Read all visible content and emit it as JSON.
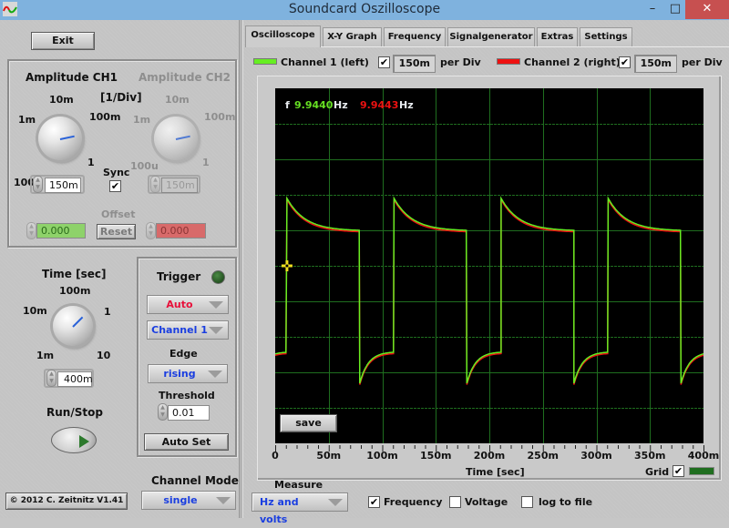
{
  "window": {
    "title": "Soundcard Oszilloscope",
    "minimize": "–",
    "maximize": "□",
    "close": "✕"
  },
  "left": {
    "exit_label": "Exit",
    "amplitude": {
      "ch1_title": "Amplitude CH1",
      "ch2_title": "Amplitude CH2",
      "unit": "[1/Div]",
      "scale_labels": [
        "100u",
        "1m",
        "10m",
        "100m",
        "1"
      ],
      "ch1_value": "150m",
      "ch2_value": "150m",
      "sync_label": "Sync",
      "sync_checked": true,
      "offset_label": "Offset",
      "offset_ch1": "0.000",
      "offset_ch2": "0.000",
      "reset_label": "Reset"
    },
    "time": {
      "title": "Time [sec]",
      "scale_labels": [
        "1m",
        "10m",
        "100m",
        "1",
        "10"
      ],
      "value": "400m"
    },
    "trigger": {
      "title": "Trigger",
      "mode": "Auto",
      "channel": "Channel 1",
      "edge_label": "Edge",
      "edge": "rising",
      "threshold_label": "Threshold",
      "threshold": "0.01",
      "auto_set_label": "Auto Set"
    },
    "run_stop_label": "Run/Stop",
    "channel_mode_label": "Channel Mode",
    "channel_mode": "single",
    "copyright": "© 2012  C. Zeitnitz V1.41"
  },
  "tabs": [
    {
      "label": "Oscilloscope",
      "active": true
    },
    {
      "label": "X-Y Graph",
      "active": false
    },
    {
      "label": "Frequency",
      "active": false
    },
    {
      "label": "Signalgenerator",
      "active": false
    },
    {
      "label": "Extras",
      "active": false
    },
    {
      "label": "Settings",
      "active": false
    }
  ],
  "channels": {
    "ch1_label": "Channel 1 (left)",
    "ch1_color": "#66ee22",
    "ch1_enabled": true,
    "ch1_per_div": "150m",
    "ch2_label": "Channel 2 (right)",
    "ch2_color": "#ee1111",
    "ch2_enabled": true,
    "ch2_per_div": "150m",
    "per_div_label": "per Div"
  },
  "readout": {
    "f_label": "f",
    "ch1_freq": "9.9440",
    "ch2_freq": "9.9443",
    "unit": "Hz"
  },
  "graph": {
    "save_label": "save",
    "xlabel": "Time [sec]",
    "grid_label": "Grid",
    "grid_checked": true,
    "grid_color": "#1f6e1f"
  },
  "measure": {
    "title": "Measure",
    "mode": "Hz and volts",
    "frequency_label": "Frequency",
    "frequency_checked": true,
    "voltage_label": "Voltage",
    "voltage_checked": false,
    "log_label": "log to file",
    "log_checked": false
  },
  "chart_data": {
    "type": "line",
    "title": "",
    "xlabel": "Time [sec]",
    "ylabel": "",
    "xlim": [
      0,
      0.4
    ],
    "ylim": [
      -0.75,
      0.75
    ],
    "x_tick_labels": [
      "0",
      "50m",
      "100m",
      "150m",
      "200m",
      "250m",
      "300m",
      "350m",
      "400m"
    ],
    "x_divisions": 8,
    "y_divisions": 10,
    "volts_per_div": 0.15,
    "grid": true,
    "trigger_marker": {
      "t": 0.011,
      "v": 0.0
    },
    "series": [
      {
        "name": "Channel 1 (left)",
        "color": "#66ee22",
        "waveform": "square (AC-coupled)",
        "frequency_hz": 9.944,
        "rising_edges_t": [
          0.011,
          0.111,
          0.211,
          0.311
        ],
        "falling_edges_t": [
          0.079,
          0.179,
          0.279,
          0.379
        ],
        "high_start_v": 0.285,
        "high_end_v": 0.15,
        "low_start_v": -0.496,
        "low_end_v": -0.365
      },
      {
        "name": "Channel 2 (right)",
        "color": "#ee1111",
        "waveform": "square (AC-coupled)",
        "frequency_hz": 9.9443,
        "rising_edges_t": [
          0.011,
          0.111,
          0.211,
          0.311
        ],
        "falling_edges_t": [
          0.079,
          0.179,
          0.279,
          0.379
        ],
        "high_start_v": 0.283,
        "high_end_v": 0.148,
        "low_start_v": -0.498,
        "low_end_v": -0.367
      }
    ]
  }
}
